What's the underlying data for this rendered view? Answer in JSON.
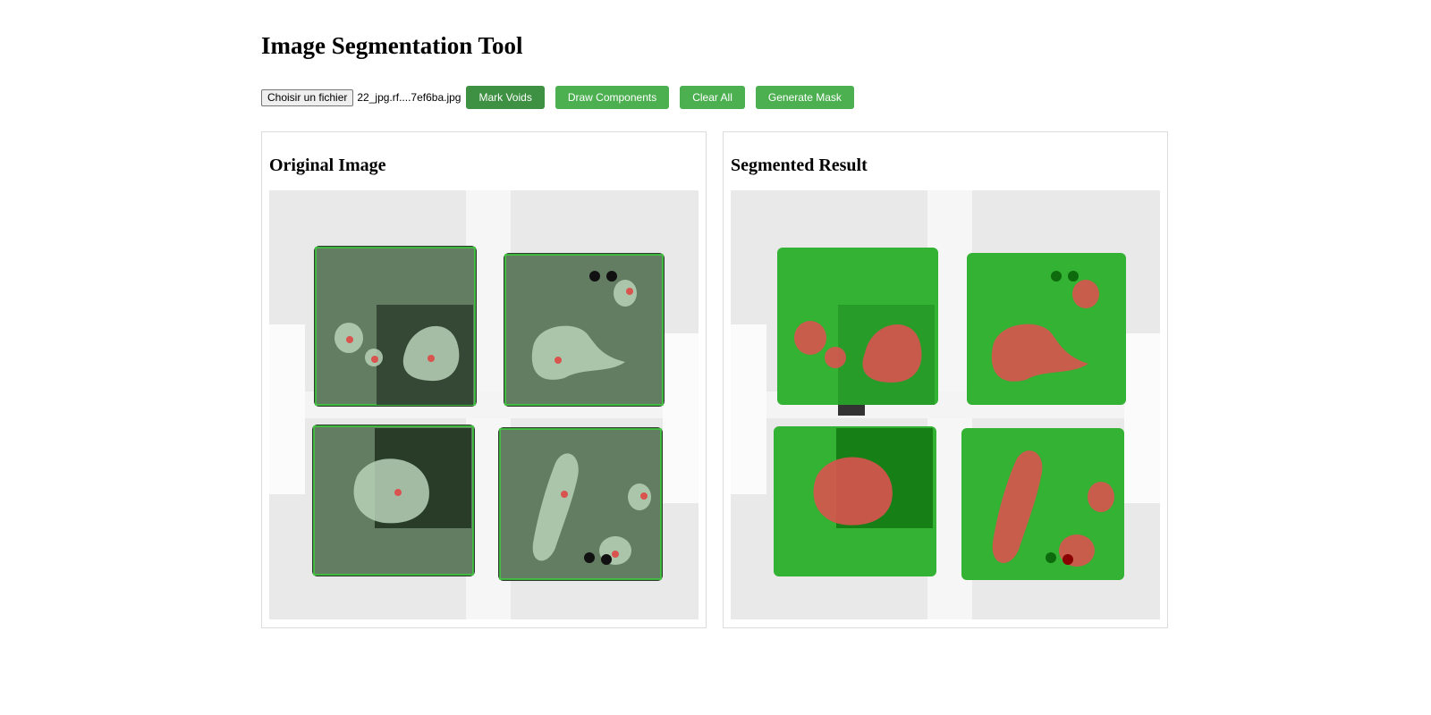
{
  "page": {
    "title": "Image Segmentation Tool"
  },
  "toolbar": {
    "file_button_label": "Choisir un fichier",
    "file_name": "22_jpg.rf....7ef6ba.jpg",
    "mark_voids_label": "Mark Voids",
    "draw_components_label": "Draw Components",
    "clear_all_label": "Clear All",
    "generate_mask_label": "Generate Mask"
  },
  "panels": {
    "original_title": "Original Image",
    "segmented_title": "Segmented Result"
  },
  "colors": {
    "accent_button": "#4caf50",
    "active_button": "#3e9142",
    "component_green": "#33b233",
    "component_outline": "#3dd43d",
    "void_red": "#d9534f",
    "overlay_gray_green": "#5f7a5f"
  },
  "annotations": {
    "components_drawn": 4,
    "voids_marked": 9
  }
}
